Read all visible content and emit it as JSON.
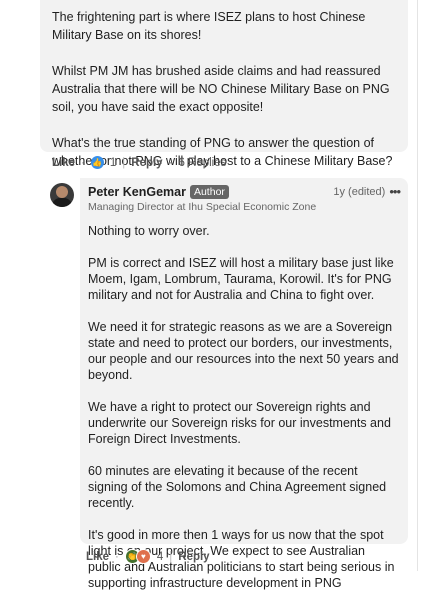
{
  "top_comment": {
    "paragraphs": [
      "The frightening part is where ISEZ plans to host Chinese Military Base on its shores!",
      "Whilst PM JM has brushed aside claims and had reassured Australia that there will be NO Chinese Military Base on PNG soil, you have said the exact opposite!",
      "What's the true standing of PNG to answer the question of whether or not PNG will play host to a Chinese Military Base?"
    ],
    "actions": {
      "like_label": "Like",
      "reaction_count": "1",
      "reply_label": "Reply",
      "replies_label": "6 Replies"
    }
  },
  "reply": {
    "author_name": "Peter KenGemar",
    "author_badge": "Author",
    "time_label": "1y (edited)",
    "headline": "Managing Director at Ihu Special Economic Zone",
    "paragraphs": [
      "Nothing to worry over.",
      "PM is correct and ISEZ will host a military base just like Moem, Igam, Lombrum, Taurama, Korowil. It's for PNG military and not for Australia and China to fight over.",
      "We need it for strategic reasons as we are a Sovereign state and need to protect our borders, our investments, our people and our resources into the next 50 years and beyond.",
      "We have a right to protect our Sovereign rights and underwrite our Sovereign risks for our investments and Foreign Direct Investments.",
      "60 minutes are elevating it because of the recent signing of the Solomons and China Agreement signed recently.",
      "It's good in more then 1 ways for us now that the spot light is on our project. We expect to see Australian public and Australian politicians to start being serious in supporting infrastructure development in PNG"
    ],
    "actions": {
      "like_label": "Like",
      "reaction_count": "4",
      "reply_label": "Reply"
    }
  },
  "icons": {
    "like_reaction": "thumbs-up-icon",
    "clap_reaction": "clap-icon",
    "heart_reaction": "heart-icon",
    "more": "ellipsis-icon"
  },
  "colors": {
    "bubble_bg": "#f2f2f2",
    "like_blue": "#378fe9",
    "badge_grey": "#666666"
  }
}
